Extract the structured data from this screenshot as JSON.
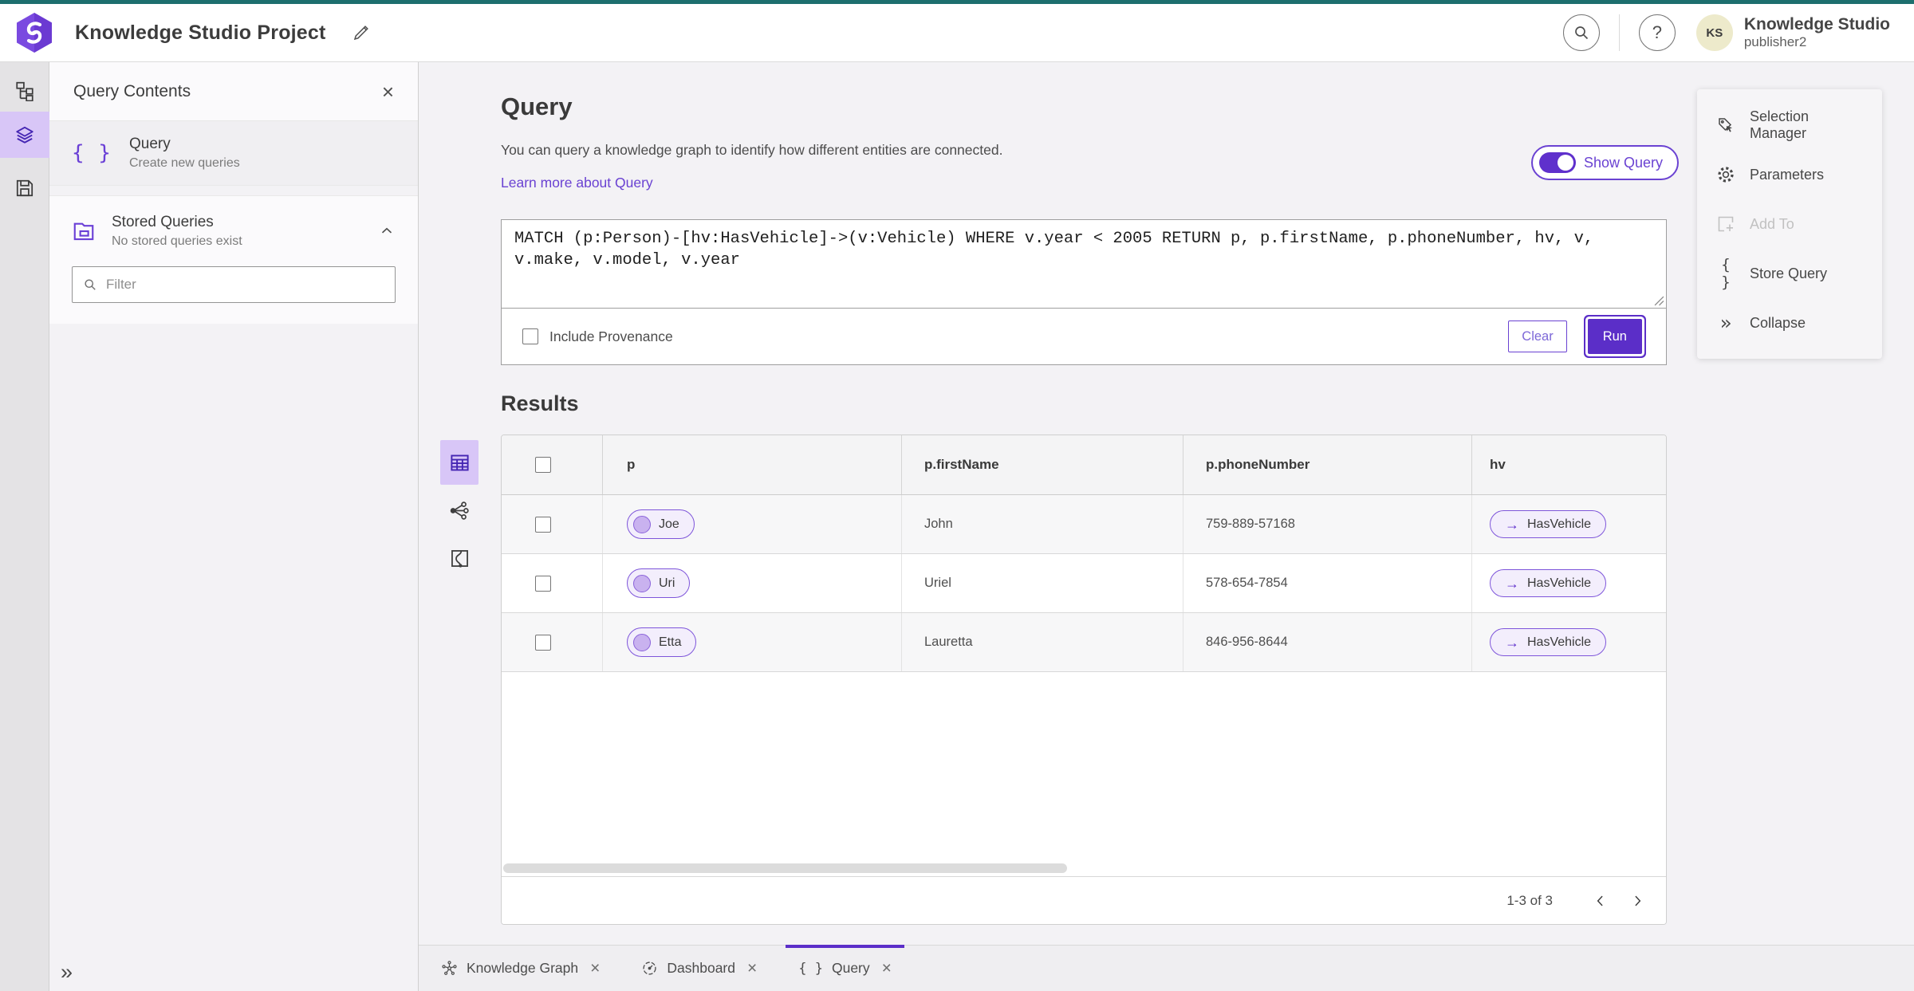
{
  "header": {
    "project_title": "Knowledge Studio Project",
    "account_name": "Knowledge Studio",
    "account_user": "publisher2",
    "avatar_initials": "KS"
  },
  "icons": {
    "close": "×",
    "help": "?",
    "braces": "{ }",
    "collapse": "»",
    "expand": "»",
    "arrow_right": "→"
  },
  "panel": {
    "title": "Query Contents",
    "query_item_title": "Query",
    "query_item_subtitle": "Create new queries",
    "stored_title": "Stored Queries",
    "stored_subtitle": "No stored queries exist",
    "filter_placeholder": "Filter"
  },
  "query": {
    "heading": "Query",
    "description": "You can query a knowledge graph to identify how different entities are connected.",
    "learn_more": "Learn more about Query",
    "show_query_label": "Show Query",
    "text": "MATCH (p:Person)-[hv:HasVehicle]->(v:Vehicle) WHERE v.year < 2005 RETURN p, p.firstName, p.phoneNumber, hv, v, v.make, v.model, v.year",
    "include_provenance_label": "Include Provenance",
    "clear_label": "Clear",
    "run_label": "Run"
  },
  "results": {
    "heading": "Results",
    "columns": [
      "p",
      "p.firstName",
      "p.phoneNumber",
      "hv"
    ],
    "rows": [
      {
        "p_label": "Joe",
        "first_name": "John",
        "phone": "759-889-57168",
        "hv_label": "HasVehicle"
      },
      {
        "p_label": "Uri",
        "first_name": "Uriel",
        "phone": "578-654-7854",
        "hv_label": "HasVehicle"
      },
      {
        "p_label": "Etta",
        "first_name": "Lauretta",
        "phone": "846-956-8644",
        "hv_label": "HasVehicle"
      }
    ],
    "pagination": "1-3 of 3"
  },
  "tools": {
    "selection_manager": "Selection Manager",
    "parameters": "Parameters",
    "add_to": "Add To",
    "store_query": "Store Query",
    "collapse": "Collapse"
  },
  "tabs": {
    "knowledge_graph": "Knowledge Graph",
    "dashboard": "Dashboard",
    "query": "Query"
  },
  "colors": {
    "accent_purple": "#5b2ec8",
    "purple_border": "#6a42d2",
    "teal_top": "#1d6f6e",
    "selected_icon_bg": "#d8c6f7",
    "pill_bg": "#f3eefc",
    "pill_border": "#7e55da"
  }
}
